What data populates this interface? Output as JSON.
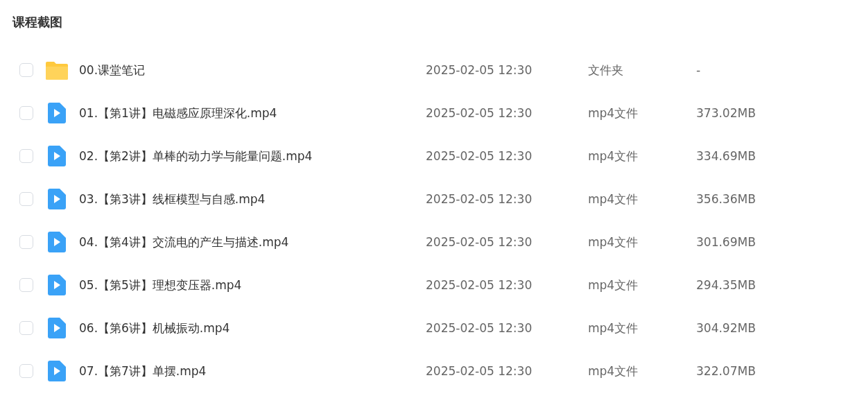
{
  "title": "课程截图",
  "files": [
    {
      "kind": "folder",
      "name": "00.课堂笔记",
      "modified": "2025-02-05 12:30",
      "type": "文件夹",
      "size": "-",
      "checked": false
    },
    {
      "kind": "video",
      "name": "01.【第1讲】电磁感应原理深化.mp4",
      "modified": "2025-02-05 12:30",
      "type": "mp4文件",
      "size": "373.02MB",
      "checked": false
    },
    {
      "kind": "video",
      "name": "02.【第2讲】单棒的动力学与能量问题.mp4",
      "modified": "2025-02-05 12:30",
      "type": "mp4文件",
      "size": "334.69MB",
      "checked": false
    },
    {
      "kind": "video",
      "name": "03.【第3讲】线框模型与自感.mp4",
      "modified": "2025-02-05 12:30",
      "type": "mp4文件",
      "size": "356.36MB",
      "checked": false
    },
    {
      "kind": "video",
      "name": "04.【第4讲】交流电的产生与描述.mp4",
      "modified": "2025-02-05 12:30",
      "type": "mp4文件",
      "size": "301.69MB",
      "checked": false
    },
    {
      "kind": "video",
      "name": "05.【第5讲】理想变压器.mp4",
      "modified": "2025-02-05 12:30",
      "type": "mp4文件",
      "size": "294.35MB",
      "checked": false
    },
    {
      "kind": "video",
      "name": "06.【第6讲】机械振动.mp4",
      "modified": "2025-02-05 12:30",
      "type": "mp4文件",
      "size": "304.92MB",
      "checked": false
    },
    {
      "kind": "video",
      "name": "07.【第7讲】单摆.mp4",
      "modified": "2025-02-05 12:30",
      "type": "mp4文件",
      "size": "322.07MB",
      "checked": false
    }
  ]
}
